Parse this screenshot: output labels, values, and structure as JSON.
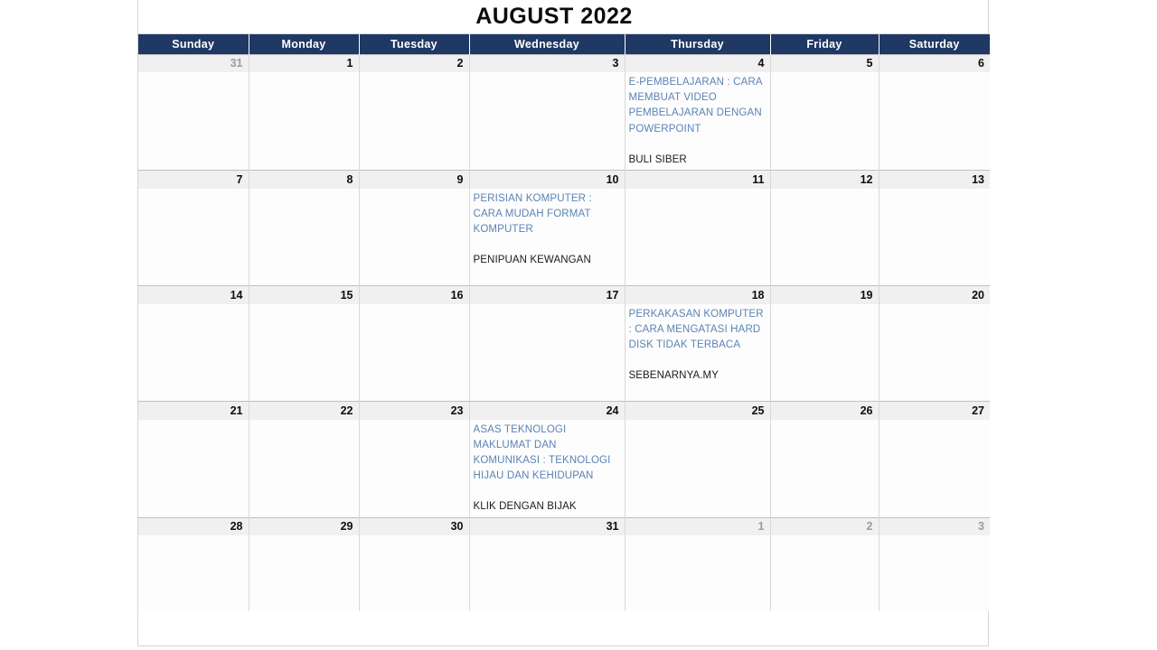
{
  "calendar": {
    "title": "AUGUST 2022",
    "weekday_headers": [
      "Sunday",
      "Monday",
      "Tuesday",
      "Wednesday",
      "Thursday",
      "Friday",
      "Saturday"
    ],
    "colors": {
      "header_background": "#1f3864",
      "header_text": "#ffffff",
      "date_row_background": "#f0f0f0",
      "cell_background": "#fdfdfd",
      "event_title_text": "#5b83b5",
      "event_source_text": "#1a1a1a",
      "muted_date_text": "#9b9b9b",
      "grid_line": "#d9d9d9"
    },
    "weeks": [
      {
        "dates": [
          {
            "day": "31",
            "muted": true
          },
          {
            "day": "1",
            "muted": false
          },
          {
            "day": "2",
            "muted": false
          },
          {
            "day": "3",
            "muted": false
          },
          {
            "day": "4",
            "muted": false
          },
          {
            "day": "5",
            "muted": false
          },
          {
            "day": "6",
            "muted": false
          }
        ],
        "events": [
          null,
          null,
          null,
          null,
          {
            "title": "E-PEMBELAJARAN : CARA MEMBUAT VIDEO PEMBELAJARAN DENGAN POWERPOINT",
            "source": "BULI SIBER"
          },
          null,
          null
        ]
      },
      {
        "dates": [
          {
            "day": "7",
            "muted": false
          },
          {
            "day": "8",
            "muted": false
          },
          {
            "day": "9",
            "muted": false
          },
          {
            "day": "10",
            "muted": false
          },
          {
            "day": "11",
            "muted": false
          },
          {
            "day": "12",
            "muted": false
          },
          {
            "day": "13",
            "muted": false
          }
        ],
        "events": [
          null,
          null,
          null,
          {
            "title": "PERISIAN KOMPUTER : CARA MUDAH FORMAT KOMPUTER",
            "source": "PENIPUAN KEWANGAN"
          },
          null,
          null,
          null
        ]
      },
      {
        "dates": [
          {
            "day": "14",
            "muted": false
          },
          {
            "day": "15",
            "muted": false
          },
          {
            "day": "16",
            "muted": false
          },
          {
            "day": "17",
            "muted": false
          },
          {
            "day": "18",
            "muted": false
          },
          {
            "day": "19",
            "muted": false
          },
          {
            "day": "20",
            "muted": false
          }
        ],
        "events": [
          null,
          null,
          null,
          null,
          {
            "title": "PERKAKASAN KOMPUTER : CARA MENGATASI HARD DISK TIDAK TERBACA",
            "source": "SEBENARNYA.MY"
          },
          null,
          null
        ]
      },
      {
        "dates": [
          {
            "day": "21",
            "muted": false
          },
          {
            "day": "22",
            "muted": false
          },
          {
            "day": "23",
            "muted": false
          },
          {
            "day": "24",
            "muted": false
          },
          {
            "day": "25",
            "muted": false
          },
          {
            "day": "26",
            "muted": false
          },
          {
            "day": "27",
            "muted": false
          }
        ],
        "events": [
          null,
          null,
          null,
          {
            "title": "ASAS TEKNOLOGI MAKLUMAT DAN KOMUNIKASI : TEKNOLOGI HIJAU DAN KEHIDUPAN",
            "source": "KLIK DENGAN BIJAK"
          },
          null,
          null,
          null
        ]
      },
      {
        "dates": [
          {
            "day": "28",
            "muted": false
          },
          {
            "day": "29",
            "muted": false
          },
          {
            "day": "30",
            "muted": false
          },
          {
            "day": "31",
            "muted": false
          },
          {
            "day": "1",
            "muted": true
          },
          {
            "day": "2",
            "muted": true
          },
          {
            "day": "3",
            "muted": true
          }
        ],
        "events": [
          null,
          null,
          null,
          null,
          null,
          null,
          null
        ]
      }
    ]
  }
}
